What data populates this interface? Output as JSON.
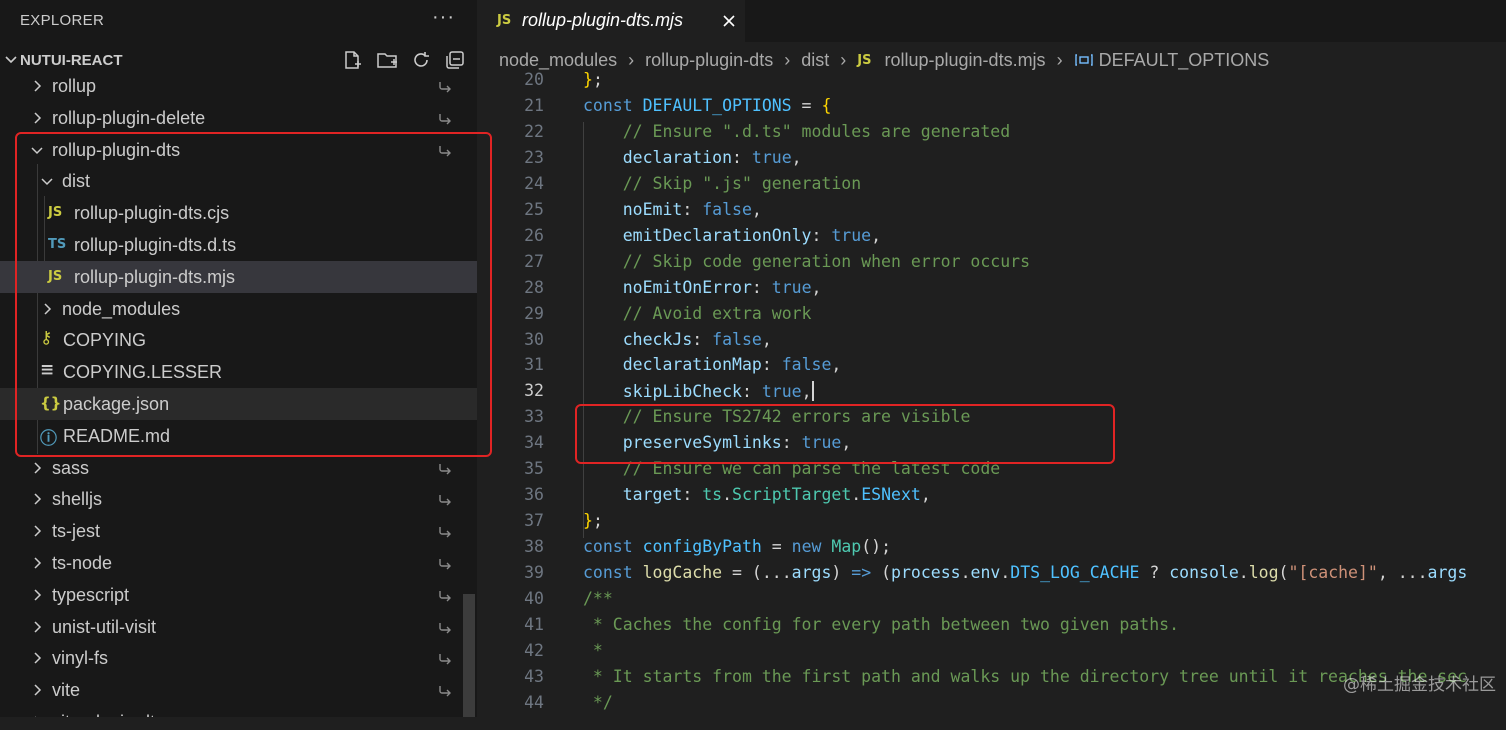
{
  "explorer": {
    "title": "EXPLORER",
    "more_label": "···",
    "project_name": "NUTUI-REACT",
    "actions": [
      "new-file-icon",
      "new-folder-icon",
      "refresh-icon",
      "collapse-all-icon"
    ]
  },
  "tree": [
    {
      "label": "rollup",
      "type": "folder",
      "expanded": false,
      "depth": 0,
      "symlink": true
    },
    {
      "label": "rollup-plugin-delete",
      "type": "folder",
      "expanded": false,
      "depth": 0,
      "symlink": true
    },
    {
      "label": "rollup-plugin-dts",
      "type": "folder",
      "expanded": true,
      "depth": 0,
      "symlink": true
    },
    {
      "label": "dist",
      "type": "folder",
      "expanded": true,
      "depth": 1
    },
    {
      "label": "rollup-plugin-dts.cjs",
      "type": "file",
      "icon": "JS",
      "depth": 2
    },
    {
      "label": "rollup-plugin-dts.d.ts",
      "type": "file",
      "icon": "TS",
      "depth": 2
    },
    {
      "label": "rollup-plugin-dts.mjs",
      "type": "file",
      "icon": "JS",
      "depth": 2,
      "selected": true
    },
    {
      "label": "node_modules",
      "type": "folder",
      "expanded": false,
      "depth": 1
    },
    {
      "label": "COPYING",
      "type": "file",
      "icon": "license",
      "depth": 1
    },
    {
      "label": "COPYING.LESSER",
      "type": "file",
      "icon": "text",
      "depth": 1
    },
    {
      "label": "package.json",
      "type": "file",
      "icon": "{}",
      "depth": 1,
      "hover": true
    },
    {
      "label": "README.md",
      "type": "file",
      "icon": "info",
      "depth": 1
    },
    {
      "label": "sass",
      "type": "folder",
      "expanded": false,
      "depth": 0,
      "symlink": true
    },
    {
      "label": "shelljs",
      "type": "folder",
      "expanded": false,
      "depth": 0,
      "symlink": true
    },
    {
      "label": "ts-jest",
      "type": "folder",
      "expanded": false,
      "depth": 0,
      "symlink": true
    },
    {
      "label": "ts-node",
      "type": "folder",
      "expanded": false,
      "depth": 0,
      "symlink": true
    },
    {
      "label": "typescript",
      "type": "folder",
      "expanded": false,
      "depth": 0,
      "symlink": true
    },
    {
      "label": "unist-util-visit",
      "type": "folder",
      "expanded": false,
      "depth": 0,
      "symlink": true
    },
    {
      "label": "vinyl-fs",
      "type": "folder",
      "expanded": false,
      "depth": 0,
      "symlink": true
    },
    {
      "label": "vite",
      "type": "folder",
      "expanded": false,
      "depth": 0,
      "symlink": true
    },
    {
      "label": "vite-plugin-dts",
      "type": "folder",
      "expanded": false,
      "depth": 0,
      "symlink": true
    }
  ],
  "tab": {
    "icon": "JS",
    "label": "rollup-plugin-dts.mjs",
    "close_icon": "close-icon"
  },
  "breadcrumb": {
    "items": [
      "node_modules",
      "rollup-plugin-dts",
      "dist",
      "rollup-plugin-dts.mjs",
      "DEFAULT_OPTIONS"
    ],
    "file_icon": "JS",
    "symbol_icon": "variable-symbol-icon"
  },
  "editor": {
    "current_line": 32,
    "lines": [
      {
        "n": 20,
        "tokens": [
          [
            "b",
            "}"
          ],
          [
            "p",
            ";"
          ]
        ]
      },
      {
        "n": 21,
        "tokens": [
          [
            "k",
            "const "
          ],
          [
            "vc",
            "DEFAULT_OPTIONS"
          ],
          [
            "o",
            " = "
          ],
          [
            "b",
            "{"
          ]
        ]
      },
      {
        "n": 22,
        "tokens": [
          [
            "p",
            "    "
          ],
          [
            "c",
            "// Ensure \".d.ts\" modules are generated"
          ]
        ]
      },
      {
        "n": 23,
        "tokens": [
          [
            "p",
            "    "
          ],
          [
            "v",
            "declaration"
          ],
          [
            "p",
            ": "
          ],
          [
            "k",
            "true"
          ],
          [
            "p",
            ","
          ]
        ]
      },
      {
        "n": 24,
        "tokens": [
          [
            "p",
            "    "
          ],
          [
            "c",
            "// Skip \".js\" generation"
          ]
        ]
      },
      {
        "n": 25,
        "tokens": [
          [
            "p",
            "    "
          ],
          [
            "v",
            "noEmit"
          ],
          [
            "p",
            ": "
          ],
          [
            "k",
            "false"
          ],
          [
            "p",
            ","
          ]
        ]
      },
      {
        "n": 26,
        "tokens": [
          [
            "p",
            "    "
          ],
          [
            "v",
            "emitDeclarationOnly"
          ],
          [
            "p",
            ": "
          ],
          [
            "k",
            "true"
          ],
          [
            "p",
            ","
          ]
        ]
      },
      {
        "n": 27,
        "tokens": [
          [
            "p",
            "    "
          ],
          [
            "c",
            "// Skip code generation when error occurs"
          ]
        ]
      },
      {
        "n": 28,
        "tokens": [
          [
            "p",
            "    "
          ],
          [
            "v",
            "noEmitOnError"
          ],
          [
            "p",
            ": "
          ],
          [
            "k",
            "true"
          ],
          [
            "p",
            ","
          ]
        ]
      },
      {
        "n": 29,
        "tokens": [
          [
            "p",
            "    "
          ],
          [
            "c",
            "// Avoid extra work"
          ]
        ]
      },
      {
        "n": 30,
        "tokens": [
          [
            "p",
            "    "
          ],
          [
            "v",
            "checkJs"
          ],
          [
            "p",
            ": "
          ],
          [
            "k",
            "false"
          ],
          [
            "p",
            ","
          ]
        ]
      },
      {
        "n": 31,
        "tokens": [
          [
            "p",
            "    "
          ],
          [
            "v",
            "declarationMap"
          ],
          [
            "p",
            ": "
          ],
          [
            "k",
            "false"
          ],
          [
            "p",
            ","
          ]
        ]
      },
      {
        "n": 32,
        "tokens": [
          [
            "p",
            "    "
          ],
          [
            "v",
            "skipLibCheck"
          ],
          [
            "p",
            ": "
          ],
          [
            "k",
            "true"
          ],
          [
            "p",
            ","
          ]
        ],
        "cursor": true
      },
      {
        "n": 33,
        "tokens": [
          [
            "p",
            "    "
          ],
          [
            "c",
            "// Ensure TS2742 errors are visible"
          ]
        ]
      },
      {
        "n": 34,
        "tokens": [
          [
            "p",
            "    "
          ],
          [
            "v",
            "preserveSymlinks"
          ],
          [
            "p",
            ": "
          ],
          [
            "k",
            "true"
          ],
          [
            "p",
            ","
          ]
        ]
      },
      {
        "n": 35,
        "tokens": [
          [
            "p",
            "    "
          ],
          [
            "c",
            "// Ensure we can parse the latest code"
          ]
        ]
      },
      {
        "n": 36,
        "tokens": [
          [
            "p",
            "    "
          ],
          [
            "v",
            "target"
          ],
          [
            "p",
            ": "
          ],
          [
            "t",
            "ts"
          ],
          [
            "p",
            "."
          ],
          [
            "t",
            "ScriptTarget"
          ],
          [
            "p",
            "."
          ],
          [
            "vc",
            "ESNext"
          ],
          [
            "p",
            ","
          ]
        ]
      },
      {
        "n": 37,
        "tokens": [
          [
            "b",
            "}"
          ],
          [
            "p",
            ";"
          ]
        ]
      },
      {
        "n": 38,
        "tokens": [
          [
            "k",
            "const "
          ],
          [
            "vc",
            "configByPath"
          ],
          [
            "o",
            " = "
          ],
          [
            "k",
            "new "
          ],
          [
            "t",
            "Map"
          ],
          [
            "p",
            "();"
          ]
        ]
      },
      {
        "n": 39,
        "tokens": [
          [
            "k",
            "const "
          ],
          [
            "f",
            "logCache"
          ],
          [
            "o",
            " = "
          ],
          [
            "p",
            "(..."
          ],
          [
            "v",
            "args"
          ],
          [
            "p",
            ") "
          ],
          [
            "k",
            "=>"
          ],
          [
            "p",
            " ("
          ],
          [
            "v",
            "process"
          ],
          [
            "p",
            "."
          ],
          [
            "v",
            "env"
          ],
          [
            "p",
            "."
          ],
          [
            "vc",
            "DTS_LOG_CACHE"
          ],
          [
            "p",
            " ? "
          ],
          [
            "v",
            "console"
          ],
          [
            "p",
            "."
          ],
          [
            "f",
            "log"
          ],
          [
            "p",
            "("
          ],
          [
            "s",
            "\"[cache]\""
          ],
          [
            "p",
            ", ..."
          ],
          [
            "v",
            "args"
          ]
        ]
      },
      {
        "n": 40,
        "tokens": [
          [
            "c",
            "/**"
          ]
        ]
      },
      {
        "n": 41,
        "tokens": [
          [
            "c",
            " * Caches the config for every path between two given paths."
          ]
        ]
      },
      {
        "n": 42,
        "tokens": [
          [
            "c",
            " *"
          ]
        ]
      },
      {
        "n": 43,
        "tokens": [
          [
            "c",
            " * It starts from the first path and walks up the directory tree until it reaches the sec"
          ]
        ]
      },
      {
        "n": 44,
        "tokens": [
          [
            "c",
            " */"
          ]
        ]
      }
    ]
  },
  "watermark": "@稀土掘金技术社区",
  "colors": {
    "highlight_border": "#e02424",
    "sidebar_bg": "#181818",
    "editor_bg": "#1f1f1f",
    "selected_row": "#37373d"
  }
}
